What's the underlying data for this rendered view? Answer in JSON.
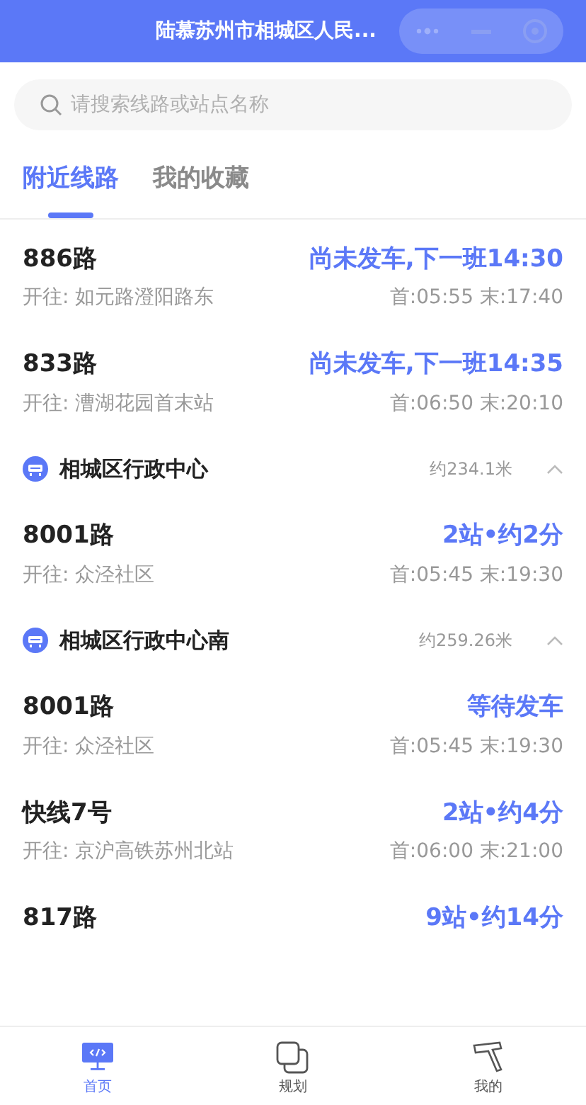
{
  "header": {
    "title": "陆慕苏州市相城区人民..."
  },
  "search": {
    "placeholder": "请搜索线路或站点名称"
  },
  "tabs": [
    {
      "label": "附近线路",
      "selected": true
    },
    {
      "label": "我的收藏",
      "selected": false
    }
  ],
  "items": [
    {
      "kind": "route",
      "name": "886路",
      "status": "尚未发车,下一班14:30",
      "destination": "开往: 如元路澄阳路东",
      "hours": "首:05:55 末:17:40"
    },
    {
      "kind": "route",
      "name": "833路",
      "status": "尚未发车,下一班14:35",
      "destination": "开往: 漕湖花园首末站",
      "hours": "首:06:50 末:20:10"
    },
    {
      "kind": "stop",
      "name": "相城区行政中心",
      "distance": "约234.1米",
      "expanded": true
    },
    {
      "kind": "route",
      "name": "8001路",
      "status": "2站•约2分",
      "destination": "开往: 众泾社区",
      "hours": "首:05:45 末:19:30"
    },
    {
      "kind": "stop",
      "name": "相城区行政中心南",
      "distance": "约259.26米",
      "expanded": true
    },
    {
      "kind": "route",
      "name": "8001路",
      "status": "等待发车",
      "destination": "开往: 众泾社区",
      "hours": "首:05:45 末:19:30"
    },
    {
      "kind": "route",
      "name": "快线7号",
      "status": "2站•约4分",
      "destination": "开往: 京沪高铁苏州北站",
      "hours": "首:06:00 末:21:00"
    },
    {
      "kind": "route",
      "name": "817路",
      "status": "9站•约14分"
    }
  ],
  "nav": [
    {
      "label": "首页",
      "selected": true
    },
    {
      "label": "规划",
      "selected": false
    },
    {
      "label": "我的",
      "selected": false
    }
  ]
}
